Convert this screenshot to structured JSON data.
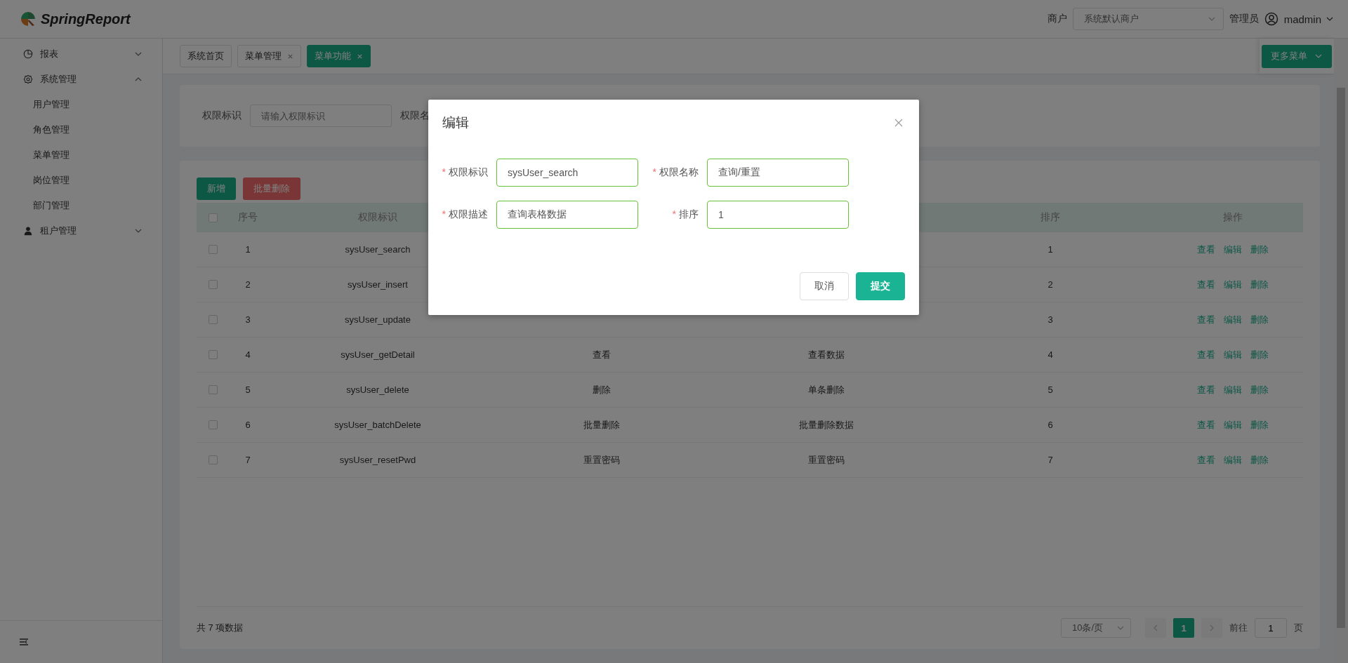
{
  "header": {
    "brand": "SpringReport",
    "merchant_label": "商户",
    "merchant_select": "系统默认商户",
    "role": "管理员",
    "user": "madmin"
  },
  "sidebar": {
    "items": [
      {
        "label": "报表",
        "expanded": false
      },
      {
        "label": "系统管理",
        "expanded": true,
        "children": [
          {
            "label": "用户管理",
            "selected": false
          },
          {
            "label": "角色管理",
            "selected": false
          },
          {
            "label": "菜单管理",
            "selected": false
          },
          {
            "label": "岗位管理",
            "selected": false
          },
          {
            "label": "部门管理",
            "selected": false
          }
        ]
      },
      {
        "label": "租户管理",
        "expanded": false
      }
    ]
  },
  "tabs": [
    {
      "label": "系统首页",
      "selected": false,
      "closable": false
    },
    {
      "label": "菜单管理",
      "selected": false,
      "closable": true
    },
    {
      "label": "菜单功能",
      "selected": true,
      "closable": true
    }
  ],
  "more_menu": "更多菜单",
  "search": {
    "fields": [
      {
        "label": "权限标识",
        "placeholder": "请输入权限标识"
      },
      {
        "label": "权限名"
      }
    ]
  },
  "toolbar": {
    "add": "新增",
    "batch_delete": "批量删除"
  },
  "table": {
    "select_all_checked": false,
    "columns": {
      "no": "序号",
      "permission_id": "权限标识",
      "sort": "排序",
      "actions": "操作"
    },
    "rows": [
      {
        "checked": false,
        "no": "1",
        "permission_id": "sysUser_search",
        "sort": "1",
        "actions": [
          "查看",
          "编辑",
          "删除"
        ]
      },
      {
        "checked": false,
        "no": "2",
        "permission_id": "sysUser_insert",
        "sort": "2",
        "actions": [
          "查看",
          "编辑",
          "删除"
        ]
      },
      {
        "checked": false,
        "no": "3",
        "permission_id": "sysUser_update",
        "sort": "3",
        "actions": [
          "查看",
          "编辑",
          "删除"
        ]
      },
      {
        "checked": false,
        "no": "4",
        "permission_id": "sysUser_getDetail",
        "column_4": "查看",
        "column_5": "查看数据",
        "sort": "4",
        "actions": [
          "查看",
          "编辑",
          "删除"
        ]
      },
      {
        "checked": false,
        "no": "5",
        "permission_id": "sysUser_delete",
        "column_4": "删除",
        "column_5": "单条删除",
        "sort": "5",
        "actions": [
          "查看",
          "编辑",
          "删除"
        ]
      },
      {
        "checked": false,
        "no": "6",
        "permission_id": "sysUser_batchDelete",
        "column_4": "批量删除",
        "column_5": "批量删除数据",
        "sort": "6",
        "actions": [
          "查看",
          "编辑",
          "删除"
        ]
      },
      {
        "checked": false,
        "no": "7",
        "permission_id": "sysUser_resetPwd",
        "column_4": "重置密码",
        "column_5": "重置密码",
        "sort": "7",
        "actions": [
          "查看",
          "编辑",
          "删除"
        ]
      }
    ]
  },
  "pagination": {
    "total": "共 7 项数据",
    "page_size": "10条/页",
    "pages": [
      {
        "label": "1",
        "selected": true
      }
    ],
    "goto_label": "前往",
    "goto_value": "1",
    "goto_suffix": "页"
  },
  "dialog": {
    "title": "编辑",
    "fields": [
      {
        "required_mark": "*",
        "label": "权限标识",
        "value": "sysUser_search"
      },
      {
        "required_mark": "*",
        "label": "权限名称",
        "value": "查询/重置"
      },
      {
        "required_mark": "*",
        "label": "权限描述",
        "value": "查询表格数据"
      },
      {
        "required_mark": "*",
        "label": "排序",
        "value": "1"
      }
    ],
    "cancel": "取消",
    "submit": "提交"
  }
}
